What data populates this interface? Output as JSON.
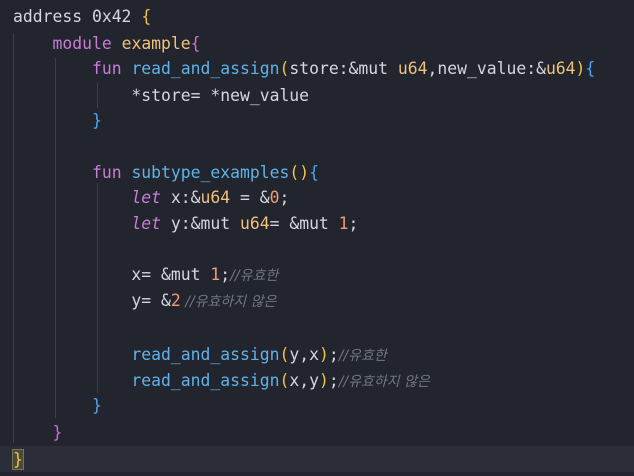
{
  "code": {
    "l1_address": "address",
    "l1_addr": "0x42",
    "l1_brace": "{",
    "l2_module": "module",
    "l2_name": "example",
    "l2_brace": "{",
    "l3_fun": "fun",
    "l3_name": "read_and_assign",
    "l3_paren_open": "(",
    "l3_p1": "store:&mut ",
    "l3_t1": "u64",
    "l3_p2": ",new_value:&",
    "l3_t2": "u64",
    "l3_paren_close": ")",
    "l3_brace": "{",
    "l4_body": "*store= *new_value",
    "l5_brace": "}",
    "l7_fun": "fun",
    "l7_name": "subtype_examples",
    "l7_parens": "()",
    "l7_brace": "{",
    "l8_let": "let",
    "l8_a": " x:&",
    "l8_t": "u64",
    "l8_b": " = &",
    "l8_n": "0",
    "l8_c": ";",
    "l9_let": "let",
    "l9_a": " y:&mut ",
    "l9_t": "u64",
    "l9_b": "= &mut ",
    "l9_n": "1",
    "l9_c": ";",
    "l11_a": "x= &mut ",
    "l11_n": "1",
    "l11_c": ";",
    "l11_comment": "//유효한",
    "l12_a": "y= &",
    "l12_n": "2",
    "l12_comment": " //유효하지 않은",
    "l14_name": "read_and_assign",
    "l14_po": "(",
    "l14_args": "y,x",
    "l14_pc": ")",
    "l14_c": ";",
    "l14_comment": "//유효한",
    "l15_name": "read_and_assign",
    "l15_po": "(",
    "l15_args": "x,y",
    "l15_pc": ")",
    "l15_c": ";",
    "l15_comment": "//유효하지 않은",
    "l16_brace": "}",
    "l17_brace": "}",
    "l18_brace": "}"
  },
  "colors": {
    "background": "#22252e",
    "keyword": "#c77dd8",
    "function": "#5fb3e8",
    "type": "#f0c27a",
    "number": "#f29a73",
    "comment": "#6f7585"
  }
}
